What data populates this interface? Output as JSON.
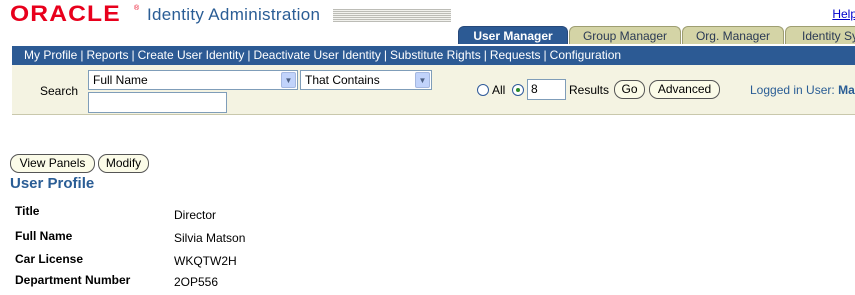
{
  "header": {
    "logo": "ORACLE",
    "app_title": "Identity Administration",
    "help": "Help"
  },
  "tabs": [
    {
      "label": "User Manager",
      "active": true
    },
    {
      "label": "Group Manager",
      "active": false
    },
    {
      "label": "Org. Manager",
      "active": false
    },
    {
      "label": "Identity Sy",
      "active": false
    }
  ],
  "nav": {
    "items": [
      "My Profile",
      "Reports",
      "Create User Identity",
      "Deactivate User Identity",
      "Substitute Rights",
      "Requests",
      "Configuration"
    ],
    "separator": "|"
  },
  "search": {
    "label": "Search",
    "field_select": "Full Name",
    "operator_select": "That Contains",
    "query_value": "",
    "radio_all_label": "All",
    "results_count": "8",
    "results_label": "Results",
    "go_button": "Go",
    "advanced_button": "Advanced",
    "logged_in_label": "Logged in User:",
    "logged_in_user": "Ma"
  },
  "profile": {
    "view_panels_button": "View Panels",
    "modify_button": "Modify",
    "section_title": "User Profile",
    "attributes": [
      {
        "label": "Title",
        "value": "Director"
      },
      {
        "label": "Full Name",
        "value": "Silvia Matson"
      },
      {
        "label": "Car License",
        "value": "WKQTW2H"
      },
      {
        "label": "Department Number",
        "value": "2OP556"
      }
    ]
  },
  "colors": {
    "brand_red": "#e8001c",
    "nav_blue": "#2c5a94",
    "title_blue": "#2a5d95",
    "tab_tan": "#d4d4a6",
    "panel_bg": "#f4f3e2"
  }
}
